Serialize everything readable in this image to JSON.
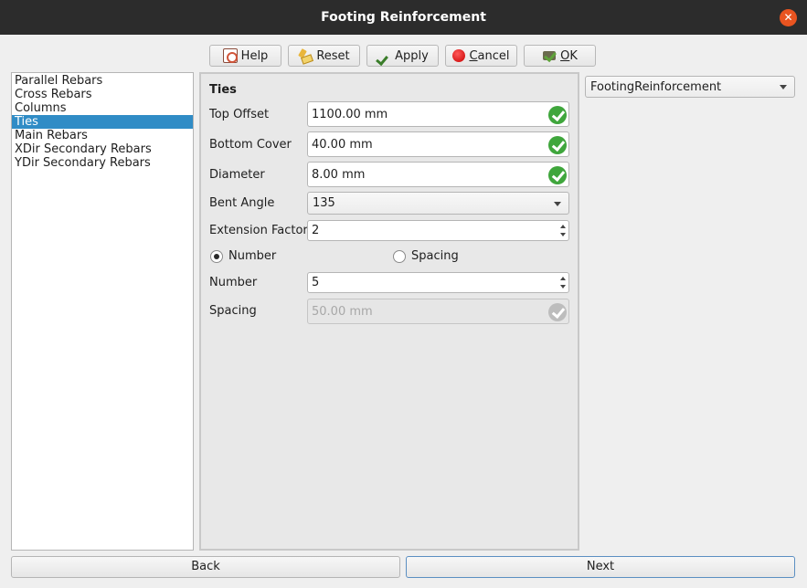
{
  "window": {
    "title": "Footing Reinforcement"
  },
  "toolbar": {
    "help": "Help",
    "reset": "Reset",
    "apply": "Apply",
    "cancel_first": "C",
    "cancel_rest": "ancel",
    "ok_first": "O",
    "ok_rest": "K"
  },
  "sidebar": {
    "items": [
      {
        "label": "Parallel Rebars"
      },
      {
        "label": "Cross Rebars"
      },
      {
        "label": "Columns"
      },
      {
        "label": "Ties",
        "selected": true
      },
      {
        "label": "Main Rebars"
      },
      {
        "label": "XDir Secondary Rebars"
      },
      {
        "label": "YDir Secondary Rebars"
      }
    ]
  },
  "form": {
    "heading": "Ties",
    "top_offset": {
      "label": "Top Offset",
      "value": "1100.00 mm"
    },
    "bottom_cover": {
      "label": "Bottom Cover",
      "value": "40.00 mm"
    },
    "diameter": {
      "label": "Diameter",
      "value": "8.00 mm"
    },
    "bent_angle": {
      "label": "Bent Angle",
      "value": "135"
    },
    "extension_factor": {
      "label": "Extension Factor",
      "value": "2"
    },
    "mode": {
      "number_label": "Number",
      "spacing_label": "Spacing",
      "selected": "Number"
    },
    "number": {
      "label": "Number",
      "value": "5"
    },
    "spacing": {
      "label": "Spacing",
      "value": "50.00 mm",
      "disabled": true
    }
  },
  "rebar_type": {
    "value": "FootingReinforcement"
  },
  "nav": {
    "back": "Back",
    "next": "Next"
  },
  "colors": {
    "selection": "#308cc6",
    "valid": "#3fa63c",
    "titlebar": "#2c2c2c",
    "close": "#e95420"
  },
  "icons": {
    "help": "help-icon",
    "reset": "broom-icon",
    "apply": "checkmark-icon",
    "cancel": "red-circle-icon",
    "ok": "ok-checkmark-icon",
    "valid": "valid-check-icon"
  }
}
